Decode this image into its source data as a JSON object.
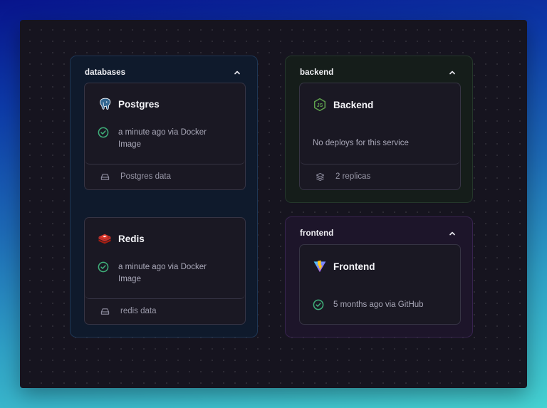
{
  "groups": {
    "databases": {
      "title": "databases"
    },
    "backend": {
      "title": "backend"
    },
    "frontend": {
      "title": "frontend"
    }
  },
  "services": {
    "postgres": {
      "name": "Postgres",
      "icon": "postgres-elephant-icon",
      "status": "a minute ago via Docker Image",
      "volume": "Postgres data"
    },
    "redis": {
      "name": "Redis",
      "icon": "redis-icon",
      "status": "a minute ago via Docker Image",
      "volume": "redis data"
    },
    "backend": {
      "name": "Backend",
      "icon": "nodejs-icon",
      "status": "No deploys for this service",
      "replicas": "2 replicas"
    },
    "frontend": {
      "name": "Frontend",
      "icon": "vite-icon",
      "status": "5 months ago via GitHub"
    }
  },
  "colors": {
    "success": "#3fb07a",
    "node_green": "#5fa04e",
    "redis_red": "#d82c20",
    "vite_purple": "#a54bff",
    "vite_yellow": "#ffc517"
  }
}
